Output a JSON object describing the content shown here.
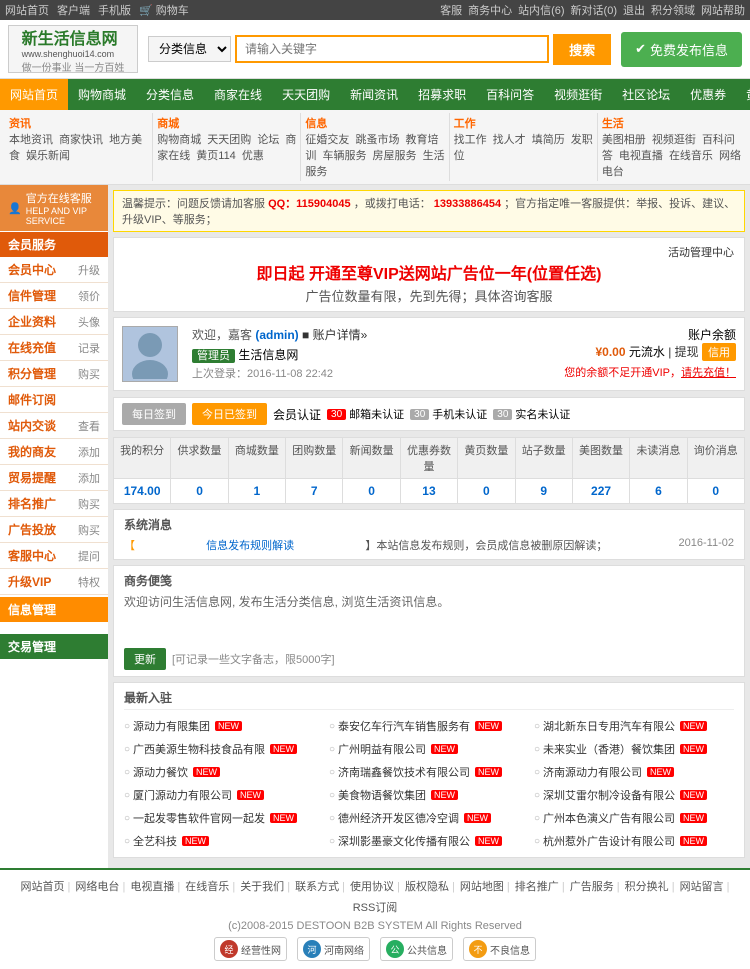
{
  "topbar": {
    "left": [
      "网站首页",
      "客户端",
      "手机版",
      "购物车"
    ],
    "right_label": "客服",
    "right_links": [
      "商务中心",
      "站内信(6)",
      "新对话(0)",
      "退出",
      "积分领域",
      "网站帮助"
    ]
  },
  "logo": {
    "site_name": "新生活信息网",
    "url": "www.shenghuoi14.com",
    "slogan": "做一份事业  当一方百姓"
  },
  "search": {
    "category_label": "分类信息",
    "placeholder": "请输入关键字",
    "search_btn": "搜索",
    "publish_btn": "免费发布信息"
  },
  "main_nav": {
    "items": [
      "网站首页",
      "购物商城",
      "分类信息",
      "商家在线",
      "天天团购",
      "新闻资讯",
      "招募求职",
      "百科问答",
      "视频逛街",
      "社区论坛",
      "优惠券",
      "黄页114"
    ]
  },
  "sub_nav": {
    "cols": [
      {
        "title": "资讯",
        "links": [
          "本地资讯",
          "商家快讯",
          "地方美食",
          "娱乐新闻"
        ]
      },
      {
        "title": "商城",
        "links": [
          "购物商城",
          "天天团购",
          "论坛",
          "商家在线",
          "黄页114",
          "优惠"
        ]
      },
      {
        "title": "信息",
        "links": [
          "征婚交友",
          "跳蚤市场",
          "教育培训",
          "车辆服务",
          "房屋服务",
          "生活服务"
        ]
      },
      {
        "title": "工作",
        "links": [
          "找工作",
          "找人才",
          "填简历",
          "发职位"
        ]
      },
      {
        "title": "生活",
        "links": [
          "美图相册",
          "视频逛街",
          "百科问答",
          "电视直播",
          "在线音乐",
          "网络电台"
        ]
      }
    ]
  },
  "service_banner": {
    "text1": "温馨提示：问题反馈请加客服",
    "qq_label": "QQ：115904045",
    "text2": "，或拨打电话：",
    "phone": "13933886454",
    "text3": "；官方指定唯一客服提供：举报、投诉、建议、升级VIP、等服务；"
  },
  "vip_banner": {
    "title": "即日起 开通至尊VIP送网站广告位一年(位置任选)",
    "subtitle": "广告位数量有限，先到先得；具体咨询客服",
    "manage_label": "活动管理中心"
  },
  "user": {
    "welcome": "欢迎，嘉客 (admin)",
    "profile_link": "账户详情",
    "member_level": "管理员",
    "site_name": "生活信息网",
    "last_login": "上次登录：2016-11-08 22:42",
    "balance_label": "账户余额",
    "balance_value": "¥0.00",
    "currency_unit": "元流水",
    "cashout_btn": "提现",
    "credit_btn": "信用",
    "vip_msg": "您的余额不足开通VIP，请先充值！",
    "vip_link": "请先充值"
  },
  "checkin": {
    "checkin_label": "每日签到",
    "today_label": "今日已签到",
    "member_cert": "会员认证",
    "email_auth": "邮箱未认证",
    "mobile_auth": "手机未认证",
    "realname_auth": "实名未认证",
    "count_30": "30"
  },
  "stats": {
    "headers": [
      "我的积分",
      "供求数量",
      "商城数量",
      "团购数量",
      "新闻数量",
      "优惠券数量",
      "黄页数量",
      "站子数量",
      "美图数量",
      "未读消息",
      "询价消息"
    ],
    "values": [
      "174.00",
      "0",
      "1",
      "7",
      "0",
      "13",
      "0",
      "9",
      "227",
      "6",
      "0"
    ]
  },
  "system_messages": {
    "title": "系统消息",
    "items": [
      {
        "text": "【信息发布规则解读】本站信息发布规则，会员成信息被删原因解读；",
        "date": "2016-11-02",
        "is_link": true
      }
    ]
  },
  "biz_notes": {
    "title": "商务便笺",
    "content": "欢迎访问生活信息网, 发布生活分类信息, 浏览生活资讯信息。",
    "save_btn": "更新",
    "hint": "[可记录一些文字备志，限5000字]"
  },
  "new_members": {
    "title": "最新入驻",
    "items": [
      "源动力有限集团",
      "泰安亿车行汽车销售服务有",
      "湖北新东日专用汽车有限公",
      "广西美源生物科技食品有限",
      "广州明益有限公司",
      "未来实业（香港）餐饮集团",
      "源动力餐饮",
      "济南瑞鑫餐饮技术有限公司",
      "济南源动力有限公司",
      "厦门源动力有限公司",
      "美食物语餐饮集团",
      "深圳艾雷尔制冷设备有限公",
      "一起发零售软件官网一起发",
      "德州经济开发区德冷空调",
      "广州本色演义广告有限公司",
      "全艺科技",
      "深圳影墨豪文化传播有限公",
      "杭州惹外广告设计有限公司"
    ]
  },
  "footer": {
    "links": [
      "网站首页",
      "网络电台",
      "电视直播",
      "在线音乐",
      "关于我们",
      "联系方式",
      "使用协议",
      "版权隐私",
      "网站地图",
      "排名推广",
      "广告服务",
      "积分换礼",
      "网站留言",
      "RSS订阅"
    ],
    "copyright": "(c)2008-2015 DESTOON B2B SYSTEM All Rights Reserved",
    "badges": [
      {
        "name": "经营性网",
        "color": "#c0392b"
      },
      {
        "name": "河南网络",
        "color": "#2980b9"
      },
      {
        "name": "公共信息",
        "color": "#27ae60"
      },
      {
        "name": "不良信息",
        "color": "#f39c12"
      }
    ]
  },
  "sidebar": {
    "service_title": "官方在线客服",
    "service_sub": "HELP AND VIP SERVICE",
    "member_section": "会员服务",
    "items_member": [
      {
        "left": "会员中心",
        "right": "升级"
      },
      {
        "left": "信件管理",
        "right": "领价"
      },
      {
        "left": "企业资料",
        "right": "头像"
      },
      {
        "left": "在线充值",
        "right": "记录"
      },
      {
        "left": "积分管理",
        "right": "购买"
      },
      {
        "left": "邮件订阅",
        "right": ""
      },
      {
        "left": "站内交谈",
        "right": "查看"
      },
      {
        "left": "我的商友",
        "right": "添加"
      },
      {
        "left": "贸易提醒",
        "right": "添加"
      },
      {
        "left": "邮件订阅",
        "right": ""
      },
      {
        "left": "排名推广",
        "right": "购买"
      },
      {
        "left": "广告投放",
        "right": "购买"
      },
      {
        "left": "客服中心",
        "right": "提问"
      },
      {
        "left": "升级VIP",
        "right": "特权"
      }
    ],
    "info_section": "信息管理",
    "trade_section": "交易管理"
  }
}
